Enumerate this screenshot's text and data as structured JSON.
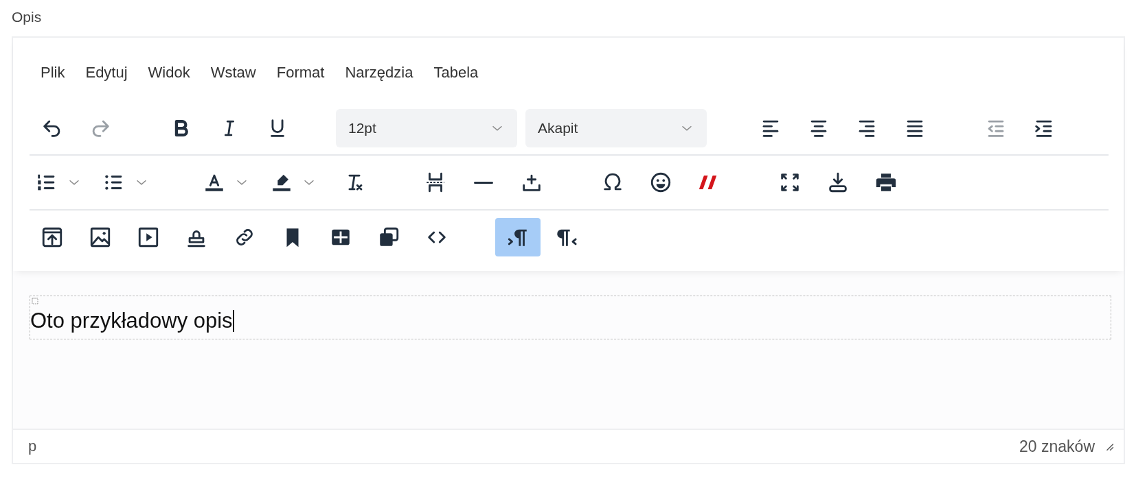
{
  "field_label": "Opis",
  "menu": [
    "Plik",
    "Edytuj",
    "Widok",
    "Wstaw",
    "Format",
    "Narzędzia",
    "Tabela"
  ],
  "toolbar_rows": [
    [
      {
        "items": [
          {
            "kind": "undo",
            "disabled": false
          },
          {
            "kind": "redo",
            "disabled": true
          }
        ]
      },
      {
        "items": [
          {
            "kind": "bold"
          },
          {
            "kind": "italic"
          },
          {
            "kind": "underline"
          }
        ]
      },
      {
        "items": [
          {
            "kind": "select",
            "value": "12pt"
          },
          {
            "kind": "select",
            "value": "Akapit"
          }
        ]
      },
      {
        "items": [
          {
            "kind": "align-left"
          },
          {
            "kind": "align-center"
          },
          {
            "kind": "align-right"
          },
          {
            "kind": "justify"
          }
        ]
      },
      {
        "items": [
          {
            "kind": "outdent",
            "disabled": true
          },
          {
            "kind": "indent",
            "disabled": false
          }
        ]
      }
    ],
    [
      {
        "items": [
          {
            "kind": "numlist"
          },
          {
            "kind": "bullist"
          }
        ]
      },
      {
        "items": [
          {
            "kind": "forecolor"
          },
          {
            "kind": "highlight"
          },
          {
            "kind": "clearformat"
          }
        ]
      },
      {
        "items": [
          {
            "kind": "pagebreak"
          },
          {
            "kind": "hr"
          },
          {
            "kind": "insert"
          }
        ]
      },
      {
        "items": [
          {
            "kind": "omega"
          },
          {
            "kind": "emoji"
          },
          {
            "kind": "quotes"
          }
        ]
      },
      {
        "items": [
          {
            "kind": "fullscreen"
          },
          {
            "kind": "download"
          },
          {
            "kind": "print"
          }
        ]
      }
    ],
    [
      {
        "items": [
          {
            "kind": "upload"
          },
          {
            "kind": "image"
          },
          {
            "kind": "media"
          },
          {
            "kind": "stamp"
          },
          {
            "kind": "link"
          },
          {
            "kind": "bookmark"
          },
          {
            "kind": "grid"
          },
          {
            "kind": "stack"
          },
          {
            "kind": "code"
          }
        ]
      },
      {
        "items": [
          {
            "kind": "ltr",
            "active": true
          },
          {
            "kind": "rtl",
            "active": false
          }
        ]
      }
    ]
  ],
  "content": {
    "text": "Oto przykładowy opis"
  },
  "status_bar": {
    "path": "p",
    "count": "20 znaków"
  }
}
